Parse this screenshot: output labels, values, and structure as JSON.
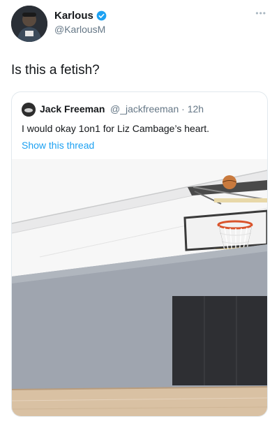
{
  "tweet": {
    "author_name": "Karlous",
    "author_handle": "@KarlousM",
    "text": "Is this a fetish?",
    "more_icon": "more-dots-icon",
    "verified_icon": "verified-badge-icon"
  },
  "quoted_tweet": {
    "author_name": "Jack Freeman",
    "author_handle": "@_jackfreeman",
    "separator": "·",
    "time": "12h",
    "text": "I would okay 1on1 for Liz Cambage’s heart.",
    "show_thread": "Show this thread"
  },
  "colors": {
    "link": "#1da1f2",
    "verified": "#1da1f2",
    "secondary_text": "#657786"
  }
}
